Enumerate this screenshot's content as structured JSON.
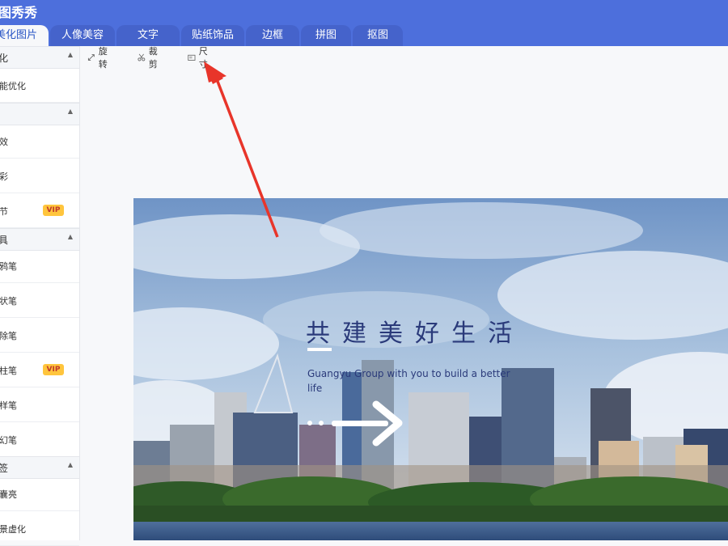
{
  "app": {
    "title": "图秀秀"
  },
  "tabs": [
    {
      "label": "美化图片",
      "active": true
    },
    {
      "label": "人像美容"
    },
    {
      "label": "文字"
    },
    {
      "label": "贴纸饰品"
    },
    {
      "label": "边框"
    },
    {
      "label": "拼图"
    },
    {
      "label": "抠图"
    }
  ],
  "sidebar": {
    "sections": [
      {
        "label": "化",
        "items": [
          {
            "label": "能优化"
          }
        ]
      },
      {
        "label": "",
        "items": [
          {
            "label": "效"
          },
          {
            "label": "彩"
          },
          {
            "label": "节",
            "vip": "VIP"
          }
        ]
      },
      {
        "label": "具",
        "items": [
          {
            "label": "鸦笔"
          },
          {
            "label": "状笔"
          },
          {
            "label": "除笔"
          },
          {
            "label": "柱笔",
            "vip": "VIP"
          },
          {
            "label": "样笔"
          },
          {
            "label": "幻笔"
          }
        ]
      },
      {
        "label": "签",
        "items": [
          {
            "label": "囊亮"
          },
          {
            "label": "景虚化"
          }
        ]
      }
    ]
  },
  "toolbar": {
    "rotate": "旋转",
    "crop": "裁剪",
    "size": "尺寸"
  },
  "poster": {
    "title": "共建美好生活",
    "subtitle": "Guangyu Group with you to build a better life"
  },
  "colors": {
    "header": "#4d6fdc",
    "accent": "#2a56c6",
    "vip": "#ffc53d",
    "annotation_arrow": "#e8352a"
  }
}
